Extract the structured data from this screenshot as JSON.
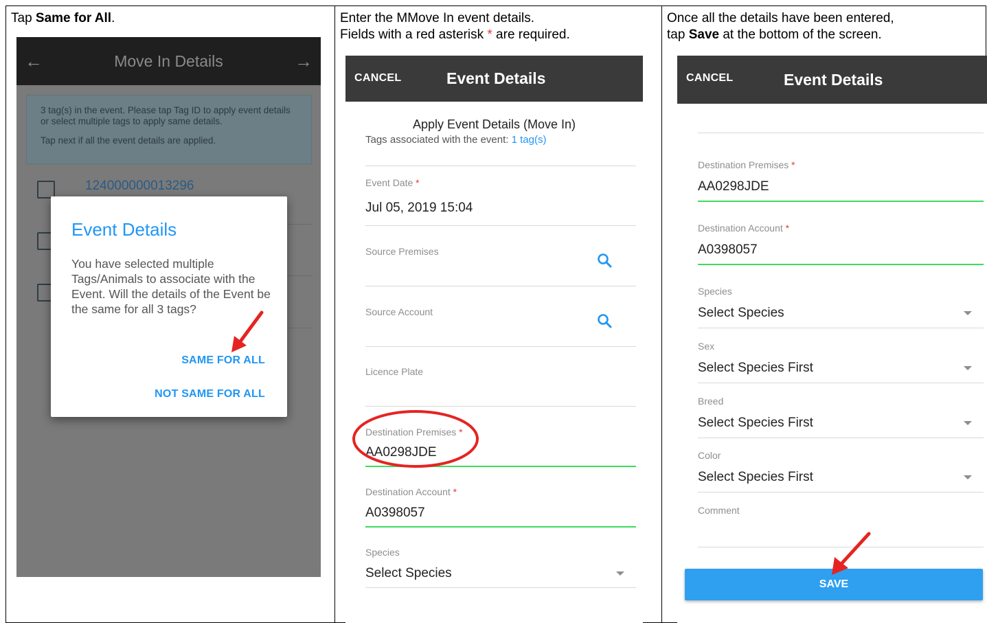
{
  "col1": {
    "instruction_prefix": "Tap ",
    "instruction_bold": "Same for All",
    "instruction_suffix": ".",
    "screen": {
      "title": "Move In Details",
      "back_icon": "←",
      "forward_icon": "→",
      "info_line1": "3 tag(s) in the event. Please tap Tag ID to apply event details or select multiple tags to apply same details.",
      "info_line2": "Tap next if all the event details are applied.",
      "tag_id": "124000000013296",
      "dialog": {
        "title": "Event Details",
        "body": "You have selected multiple Tags/Animals to associate with the Event. Will the details of the Event be the same for all 3 tags?",
        "same_button": "SAME FOR ALL",
        "not_same_button": "NOT SAME FOR ALL"
      }
    }
  },
  "col2": {
    "instruction_line1": "Enter the MMove In event details.",
    "instruction_line2_prefix": "Fields with a red asterisk ",
    "instruction_star": "*",
    "instruction_line2_suffix": " are required.",
    "screen": {
      "cancel": "CANCEL",
      "title": "Event Details",
      "apply_title": "Apply Event Details (Move In)",
      "tags_prefix": "Tags associated with the event: ",
      "tags_link": "1 tag(s)",
      "event_date_label": "Event Date",
      "event_date_value": "Jul 05, 2019 15:04",
      "source_premises_label": "Source Premises",
      "source_account_label": "Source Account",
      "licence_plate_label": "Licence Plate",
      "dest_premises_label": "Destination Premises",
      "dest_premises_value": "AA0298JDE",
      "dest_account_label": "Destination Account",
      "dest_account_value": "A0398057",
      "species_label": "Species",
      "species_value": "Select Species",
      "required_star": "*"
    }
  },
  "col3": {
    "instruction_line1": "Once all the details have been entered,",
    "instruction_line2_prefix": "tap ",
    "instruction_bold": "Save",
    "instruction_line2_suffix": " at the bottom of the screen.",
    "screen": {
      "cancel": "CANCEL",
      "title": "Event Details",
      "dest_premises_label": "Destination Premises",
      "dest_premises_value": "AA0298JDE",
      "dest_account_label": "Destination Account",
      "dest_account_value": "A0398057",
      "species_label": "Species",
      "species_value": "Select Species",
      "sex_label": "Sex",
      "sex_value": "Select Species First",
      "breed_label": "Breed",
      "breed_value": "Select Species First",
      "color_label": "Color",
      "color_value": "Select Species First",
      "comment_label": "Comment",
      "save_button": "SAVE",
      "required_star": "*"
    }
  },
  "colors": {
    "accent_blue": "#2196f3",
    "topbar_dark": "#3a3a3a",
    "valid_green": "#3ddc5a",
    "required_red": "#e53935",
    "annotation_red": "#e52421"
  },
  "icons": [
    "back-arrow-icon",
    "forward-arrow-icon",
    "checkbox-icon",
    "search-icon",
    "dropdown-arrow-icon",
    "red-pointer-arrow"
  ]
}
